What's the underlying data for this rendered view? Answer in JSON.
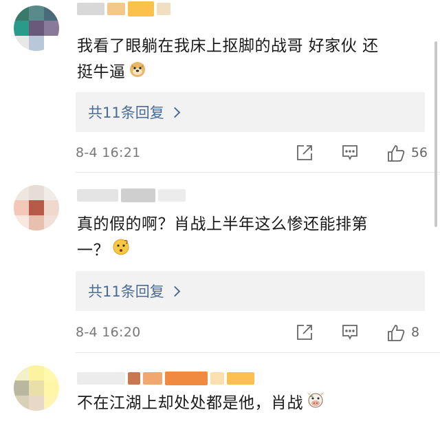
{
  "comments": [
    {
      "text_line1": "我看了眼躺在我床上抠脚的战哥 好家伙 还",
      "text_line2": "挺牛逼",
      "emoji": "doge-emoji",
      "reply_label": "共11条回复",
      "timestamp": "8-4 16:21",
      "likes": "56"
    },
    {
      "text_line1": "真的假的啊？肖战上半年这么惨还能排第",
      "text_line2": "一？",
      "emoji": "thinking-emoji",
      "reply_label": "共11条回复",
      "timestamp": "8-4 16:20",
      "likes": "8"
    },
    {
      "text_line1": "不在江湖上却处处都是他，肖战",
      "emoji": "cow-emoji"
    }
  ],
  "icons": {
    "share": "share-icon",
    "comment": "comment-icon",
    "like": "thumbs-up-icon"
  },
  "colors": {
    "reply_link": "#4a6b96",
    "reply_bg": "#f2f2f2",
    "meta_text": "#777777"
  }
}
